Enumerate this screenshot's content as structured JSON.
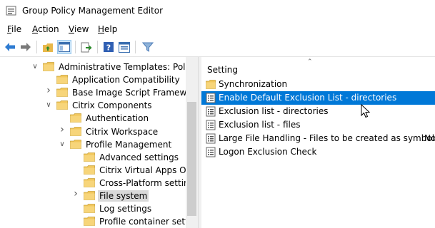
{
  "window": {
    "title": "Group Policy Management Editor"
  },
  "menu": [
    {
      "pre": "",
      "acc": "F",
      "post": "ile"
    },
    {
      "pre": "",
      "acc": "A",
      "post": "ction"
    },
    {
      "pre": "",
      "acc": "V",
      "post": "iew"
    },
    {
      "pre": "",
      "acc": "H",
      "post": "elp"
    }
  ],
  "toolbar": {
    "buttons": [
      "back-icon",
      "forward-icon",
      "up-folder-icon",
      "show-hide-tree-icon",
      "export-list-icon",
      "help-icon",
      "properties-icon",
      "filter-icon"
    ]
  },
  "tree": {
    "items": [
      {
        "label": "Administrative Templates: Policy",
        "expander": "expanded",
        "selected": false
      },
      {
        "label": "Application Compatibility",
        "expander": "none",
        "selected": false
      },
      {
        "label": "Base Image Script Framework",
        "expander": "collapsed",
        "selected": false
      },
      {
        "label": "Citrix Components",
        "expander": "expanded",
        "selected": false
      },
      {
        "label": "Authentication",
        "expander": "none",
        "selected": false
      },
      {
        "label": "Citrix Workspace",
        "expander": "collapsed",
        "selected": false
      },
      {
        "label": "Profile Management",
        "expander": "expanded",
        "selected": false
      },
      {
        "label": "Advanced settings",
        "expander": "none",
        "selected": false
      },
      {
        "label": "Citrix Virtual Apps Opti",
        "expander": "none",
        "selected": false
      },
      {
        "label": "Cross-Platform setting",
        "expander": "none",
        "selected": false
      },
      {
        "label": "File system",
        "expander": "collapsed",
        "selected": true
      },
      {
        "label": "Log settings",
        "expander": "none",
        "selected": false
      },
      {
        "label": "Profile container settin",
        "expander": "none",
        "selected": false
      }
    ]
  },
  "list": {
    "column_header": "Setting",
    "rows": [
      {
        "label": "Synchronization",
        "icon": "folder-icon",
        "selected": false,
        "state": ""
      },
      {
        "label": "Enable Default Exclusion List - directories",
        "icon": "policy-setting-icon",
        "selected": true,
        "state": ""
      },
      {
        "label": "Exclusion list - directories",
        "icon": "policy-setting-icon",
        "selected": false,
        "state": ""
      },
      {
        "label": "Exclusion list - files",
        "icon": "policy-setting-icon",
        "selected": false,
        "state": ""
      },
      {
        "label": "Large File Handling - Files to be created as symboli...",
        "icon": "policy-setting-icon",
        "selected": false,
        "state": "No"
      },
      {
        "label": "Logon Exclusion Check",
        "icon": "policy-setting-icon",
        "selected": false,
        "state": ""
      }
    ]
  },
  "colors": {
    "selection": "#0078d7",
    "tree_selection": "#d9d9d9",
    "folder": "#f2c75c"
  }
}
